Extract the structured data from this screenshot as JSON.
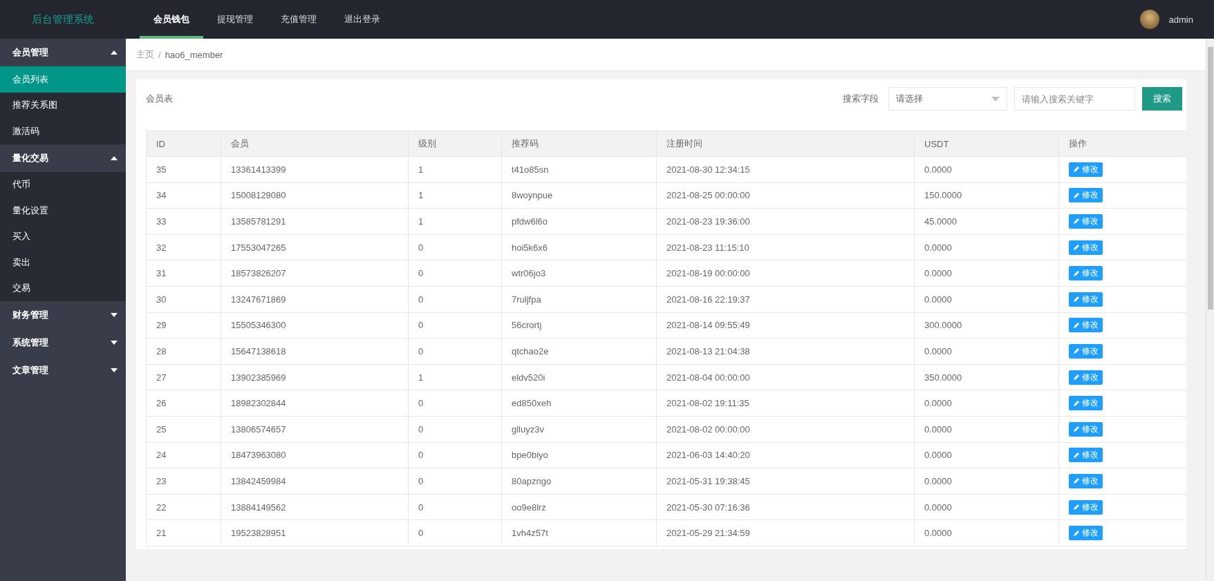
{
  "header": {
    "logo": "后台管理系统",
    "nav": [
      {
        "label": "会员钱包",
        "selected": true
      },
      {
        "label": "提现管理",
        "selected": false
      },
      {
        "label": "充值管理",
        "selected": false
      },
      {
        "label": "退出登录",
        "selected": false
      }
    ],
    "user": "admin"
  },
  "sidebar": [
    {
      "label": "会员管理",
      "expanded": true,
      "children": [
        {
          "label": "会员列表",
          "selected": true
        },
        {
          "label": "推荐关系图",
          "selected": false
        },
        {
          "label": "激活码",
          "selected": false
        }
      ]
    },
    {
      "label": "量化交易",
      "expanded": true,
      "children": [
        {
          "label": "代币",
          "selected": false
        },
        {
          "label": "量化设置",
          "selected": false
        },
        {
          "label": "买入",
          "selected": false
        },
        {
          "label": "卖出",
          "selected": false
        },
        {
          "label": "交易",
          "selected": false
        }
      ]
    },
    {
      "label": "财务管理",
      "expanded": false
    },
    {
      "label": "系统管理",
      "expanded": false
    },
    {
      "label": "文章管理",
      "expanded": false
    }
  ],
  "breadcrumb": {
    "home": "主页",
    "separator": "/",
    "current": "hao6_member"
  },
  "card": {
    "title": "会员表",
    "search_label": "搜索字段",
    "select_placeholder": "请选择",
    "keyword_placeholder": "请输入搜索关键字",
    "search_button": "搜索"
  },
  "table": {
    "columns": [
      "ID",
      "会员",
      "级别",
      "推荐码",
      "注册时间",
      "USDT",
      "操作"
    ],
    "rows": [
      [
        "35",
        "13361413399",
        "1",
        "t41o85sn",
        "2021-08-30 12:34:15",
        "0.0000",
        "修改"
      ],
      [
        "34",
        "15008129080",
        "1",
        "8woynpue",
        "2021-08-25 00:00:00",
        "150.0000",
        "修改"
      ],
      [
        "33",
        "13585781291",
        "1",
        "pfdw6l6o",
        "2021-08-23 19:36:00",
        "45.0000",
        "修改"
      ],
      [
        "32",
        "17553047265",
        "0",
        "hoi5k6x6",
        "2021-08-23 11:15:10",
        "0.0000",
        "修改"
      ],
      [
        "31",
        "18573826207",
        "0",
        "wtr06jo3",
        "2021-08-19 00:00:00",
        "0.0000",
        "修改"
      ],
      [
        "30",
        "13247671869",
        "0",
        "7ruljfpa",
        "2021-08-16 22:19:37",
        "0.0000",
        "修改"
      ],
      [
        "29",
        "15505346300",
        "0",
        "56crortj",
        "2021-08-14 09:55:49",
        "300.0000",
        "修改"
      ],
      [
        "28",
        "15647138618",
        "0",
        "qtchao2e",
        "2021-08-13 21:04:38",
        "0.0000",
        "修改"
      ],
      [
        "27",
        "13902385969",
        "1",
        "eldv520i",
        "2021-08-04 00:00:00",
        "350.0000",
        "修改"
      ],
      [
        "26",
        "18982302844",
        "0",
        "ed850xeh",
        "2021-08-02 19:11:35",
        "0.0000",
        "修改"
      ],
      [
        "25",
        "13806574657",
        "0",
        "glluyz3v",
        "2021-08-02 00:00:00",
        "0.0000",
        "修改"
      ],
      [
        "24",
        "18473963080",
        "0",
        "bpe0biyo",
        "2021-06-03 14:40:20",
        "0.0000",
        "修改"
      ],
      [
        "23",
        "13842459984",
        "0",
        "80apzngo",
        "2021-05-31 19:38:45",
        "0.0000",
        "修改"
      ],
      [
        "22",
        "13884149562",
        "0",
        "oo9e8lrz",
        "2021-05-30 07:16:36",
        "0.0000",
        "修改"
      ],
      [
        "21",
        "19523828951",
        "0",
        "1vh4z57t",
        "2021-05-29 21:34:59",
        "0.0000",
        "修改"
      ]
    ]
  }
}
